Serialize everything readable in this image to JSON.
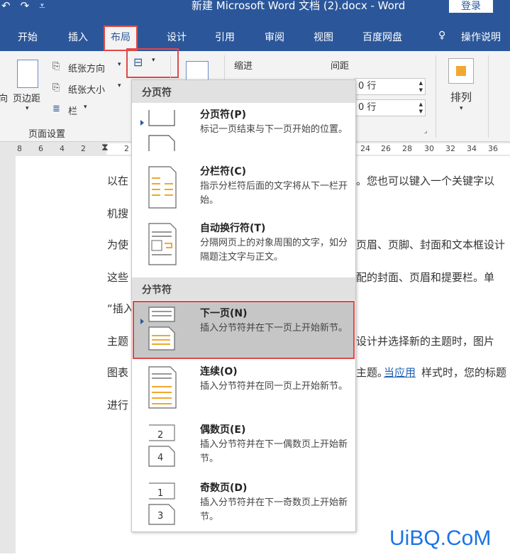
{
  "titlebar": {
    "undo_icon": "undo-icon",
    "redo_icon": "redo-icon",
    "customize_icon": "customize-qat-icon",
    "title": "新建 Microsoft Word 文档 (2).docx - Word",
    "login": "登录"
  },
  "tabs": [
    "开始",
    "插入",
    "布局",
    "设计",
    "引用",
    "审阅",
    "视图",
    "百度网盘",
    "操作说明"
  ],
  "tell_me_icon": "lightbulb-icon",
  "ribbon": {
    "orientation_partial": "向",
    "margins": "页边距",
    "orientation": "纸张方向",
    "size": "纸张大小",
    "columns": "栏",
    "group_page_setup": "页面设置",
    "indent_label": "缩进",
    "spacing_label": "间距",
    "spacing_before": "0 行",
    "spacing_after": "0 行",
    "arrange": "排列"
  },
  "ruler": [
    "8",
    "6",
    "4",
    "2",
    "2",
    "24",
    "26",
    "28",
    "30",
    "32",
    "34",
    "36"
  ],
  "document": {
    "lines": [
      "以在",
      "。您也可以键入一个关键字以",
      "机搜",
      "为使",
      "页眉、页脚、封面和文本框设计",
      "这些",
      "配的封面、页眉和提要栏。单",
      "“插入",
      "主题",
      "设计并选择新的主题时，图片",
      "图表",
      "主题。",
      "当应用",
      "样式时，您的标题",
      "进行"
    ]
  },
  "breaks_menu": {
    "section1": "分页符",
    "section2": "分节符",
    "items": [
      {
        "title": "分页符(P)",
        "desc": "标记一页结束与下一页开始的位置。",
        "icon": "page-break-icon"
      },
      {
        "title": "分栏符(C)",
        "desc": "指示分栏符后面的文字将从下一栏开始。",
        "icon": "column-break-icon"
      },
      {
        "title": "自动换行符(T)",
        "desc": "分隔网页上的对象周围的文字，如分隔题注文字与正文。",
        "icon": "text-wrapping-break-icon"
      },
      {
        "title": "下一页(N)",
        "desc": "插入分节符并在下一页上开始新节。",
        "icon": "next-page-section-icon",
        "selected": true
      },
      {
        "title": "连续(O)",
        "desc": "插入分节符并在同一页上开始新节。",
        "icon": "continuous-section-icon"
      },
      {
        "title": "偶数页(E)",
        "desc": "插入分节符并在下一偶数页上开始新节。",
        "icon": "even-page-section-icon",
        "badge": "2",
        "badge2": "4"
      },
      {
        "title": "奇数页(D)",
        "desc": "插入分节符并在下一奇数页上开始新节。",
        "icon": "odd-page-section-icon",
        "badge": "1",
        "badge2": "3"
      }
    ]
  },
  "watermark": "UiBQ.CoM",
  "colors": {
    "accent": "#2b579a",
    "highlight_border": "#e04848",
    "selected_bg": "#c6c6c6"
  }
}
